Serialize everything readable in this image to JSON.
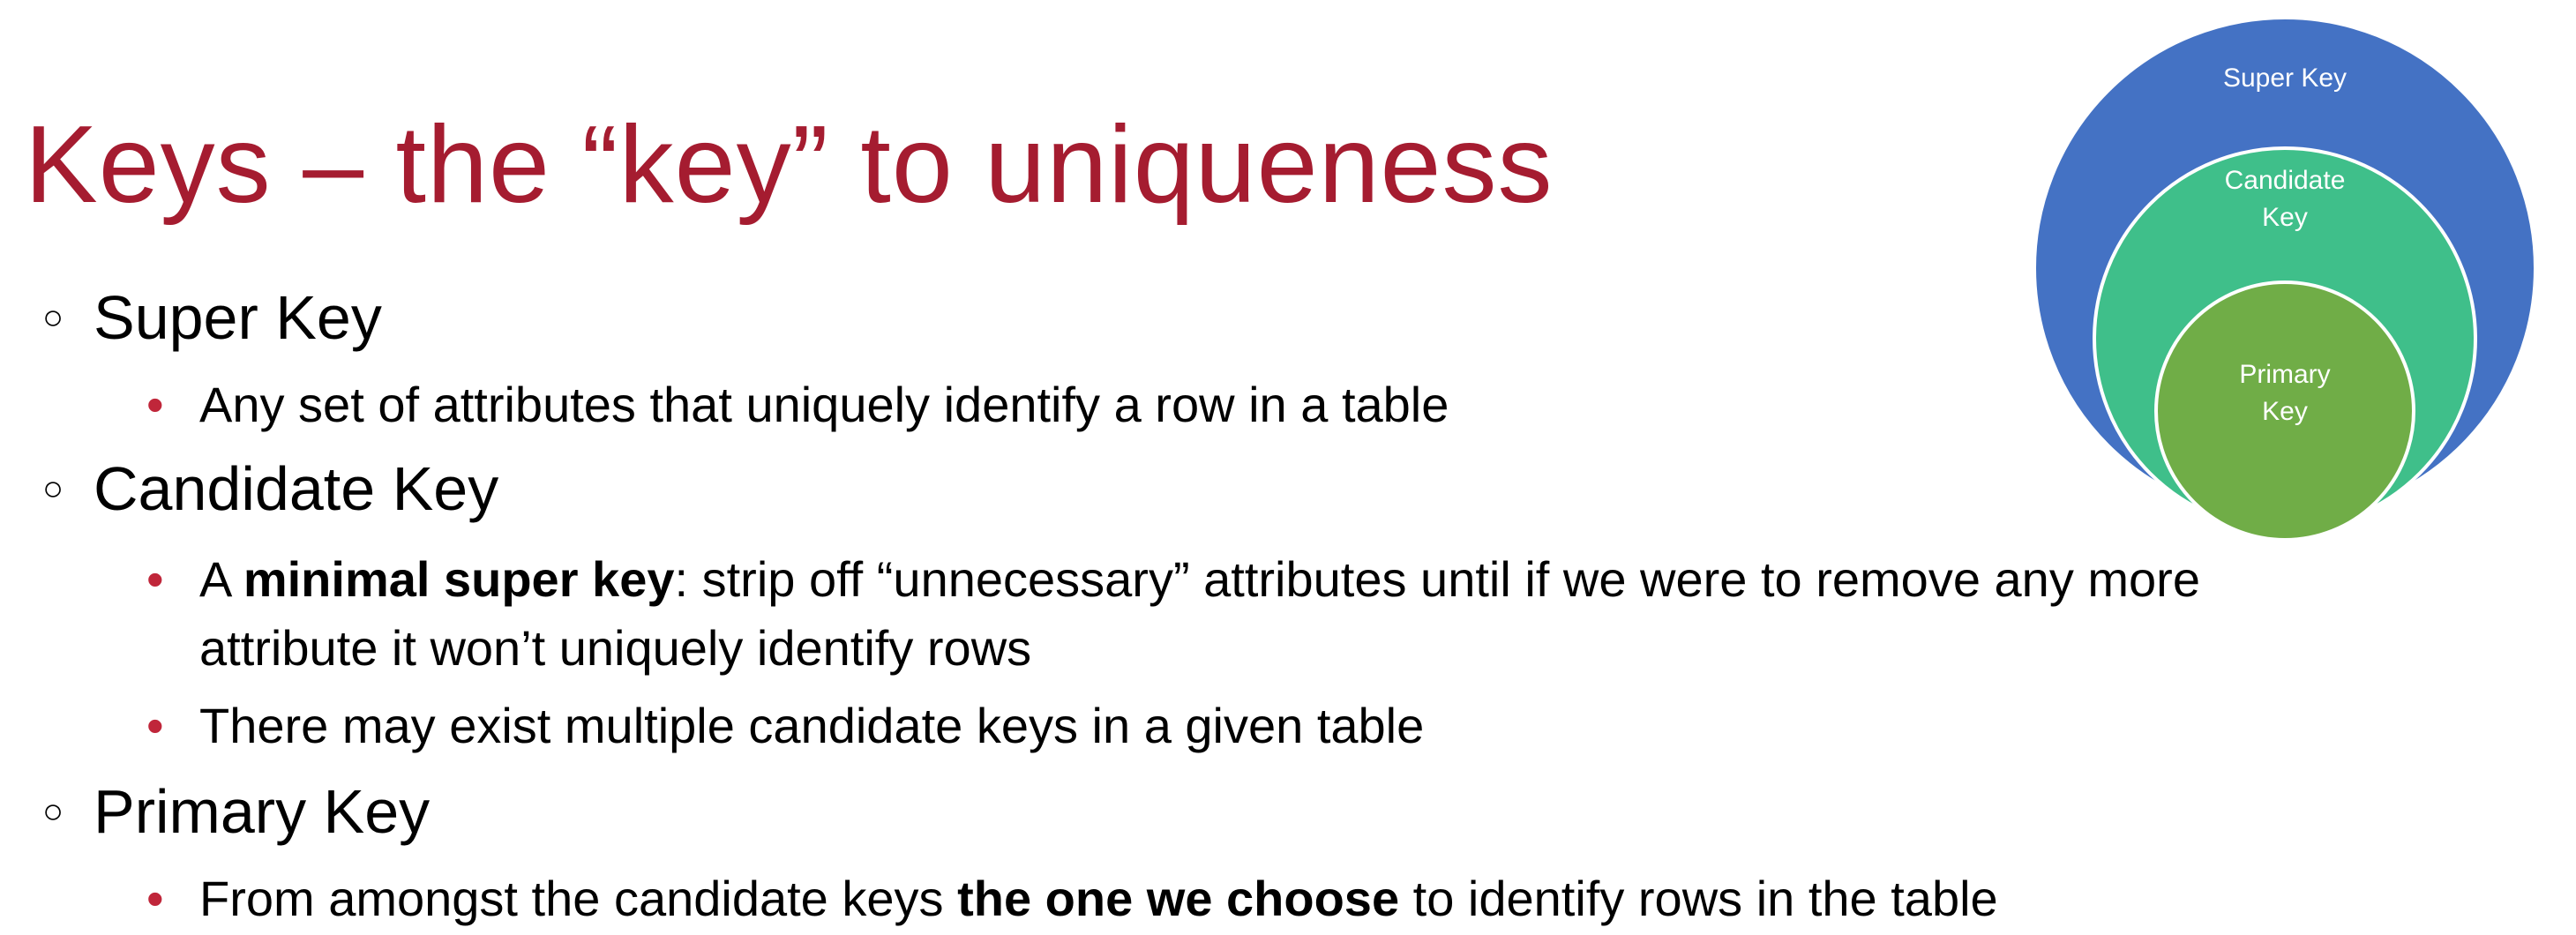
{
  "title": "Keys – the “key” to uniqueness",
  "items": [
    {
      "heading": "Super Key",
      "sub": [
        {
          "text": "Any set of attributes that uniquely identify a row in a table"
        }
      ]
    },
    {
      "heading": "Candidate Key",
      "sub": [
        {
          "pre": "A ",
          "bold": "minimal super key",
          "post": ": strip off “unnecessary” attributes until if we were to remove any more",
          "cont": "attribute it won’t uniquely identify rows"
        },
        {
          "text": "There may exist multiple candidate keys in a given table"
        }
      ]
    },
    {
      "heading": "Primary Key",
      "sub": [
        {
          "pre": "From amongst the candidate keys ",
          "bold": "the one we choose",
          "post": " to identify rows in the table"
        }
      ]
    }
  ],
  "diagram": {
    "outer": {
      "label": "Super Key",
      "color": "#4472c4"
    },
    "middle": {
      "label_line1": "Candidate",
      "label_line2": "Key",
      "color": "#3fbf8a"
    },
    "inner": {
      "label_line1": "Primary",
      "label_line2": "Key",
      "color": "#70ad47"
    }
  },
  "colors": {
    "title": "#a51c30",
    "bullet": "#c0263a"
  }
}
